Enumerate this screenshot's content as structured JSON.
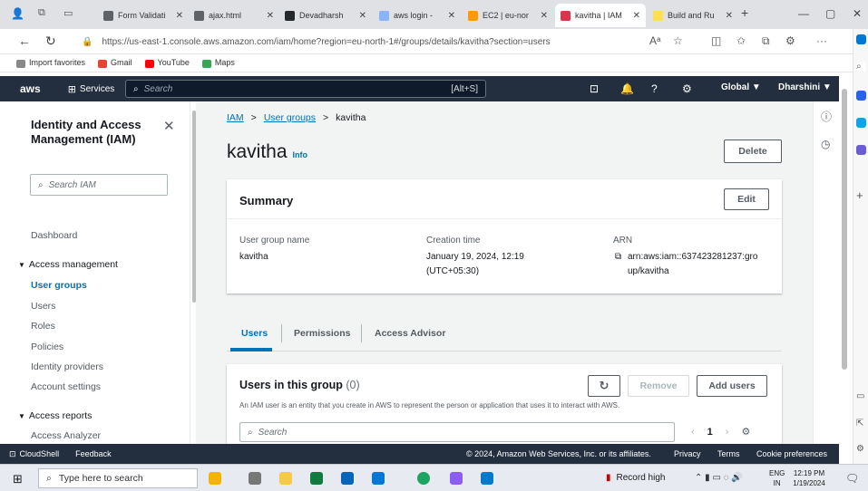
{
  "browser": {
    "tabs": [
      {
        "label": "Form Validati",
        "color": "#5f6368"
      },
      {
        "label": "ajax.html",
        "color": "#5f6368"
      },
      {
        "label": "Devadharsh",
        "color": "#24292e"
      },
      {
        "label": "aws login -",
        "color": "#8ab4f8"
      },
      {
        "label": "EC2 | eu-nor",
        "color": "#ff9900"
      },
      {
        "label": "kavitha | IAM",
        "color": "#dd344c",
        "active": true
      },
      {
        "label": "Build and Ru",
        "color": "#ffe04d"
      }
    ],
    "url": "https://us-east-1.console.aws.amazon.com/iam/home?region=eu-north-1#/groups/details/kavitha?section=users",
    "favorites": [
      {
        "label": "Import favorites",
        "color": "#888888"
      },
      {
        "label": "Gmail",
        "color": "#ea4335"
      },
      {
        "label": "YouTube",
        "color": "#ff0000"
      },
      {
        "label": "Maps",
        "color": "#34a853"
      }
    ]
  },
  "aws_nav": {
    "logo": "aws",
    "services": "Services",
    "search_placeholder": "Search",
    "search_shortcut": "[Alt+S]",
    "region": "Global ▼",
    "user": "Dharshini ▼"
  },
  "left_nav": {
    "title": "Identity and Access Management (IAM)",
    "search_placeholder": "Search IAM",
    "dashboard": "Dashboard",
    "access_management": "Access management",
    "items": [
      "User groups",
      "Users",
      "Roles",
      "Policies",
      "Identity providers",
      "Account settings"
    ],
    "access_reports": "Access reports",
    "access_analyzer": "Access Analyzer"
  },
  "main": {
    "breadcrumb": [
      "IAM",
      "User groups",
      "kavitha"
    ],
    "title": "kavitha",
    "info": "Info",
    "delete_label": "Delete",
    "summary": {
      "title": "Summary",
      "edit_label": "Edit",
      "group_name_label": "User group name",
      "group_name_value": "kavitha",
      "creation_label": "Creation time",
      "creation_value_1": "January 19, 2024, 12:19",
      "creation_value_2": "(UTC+05:30)",
      "arn_label": "ARN",
      "arn_value_1": "arn:aws:iam::637423281237:gro",
      "arn_value_2": "up/kavitha"
    },
    "tabs": [
      "Users",
      "Permissions",
      "Access Advisor"
    ],
    "users_section": {
      "title": "Users in this group",
      "count": "(0)",
      "description": "An IAM user is an entity that you create in AWS to represent the person or application that uses it to interact with AWS.",
      "remove_label": "Remove",
      "add_label": "Add users",
      "search_placeholder": "Search",
      "page": "1"
    }
  },
  "footer": {
    "cloudshell": "CloudShell",
    "feedback": "Feedback",
    "copyright": "© 2024, Amazon Web Services, Inc. or its affiliates.",
    "privacy": "Privacy",
    "terms": "Terms",
    "cookies": "Cookie preferences"
  },
  "taskbar": {
    "search_placeholder": "Type here to search",
    "record": "Record high",
    "lang_1": "ENG",
    "lang_2": "IN",
    "time": "12:19 PM",
    "date": "1/19/2024"
  }
}
